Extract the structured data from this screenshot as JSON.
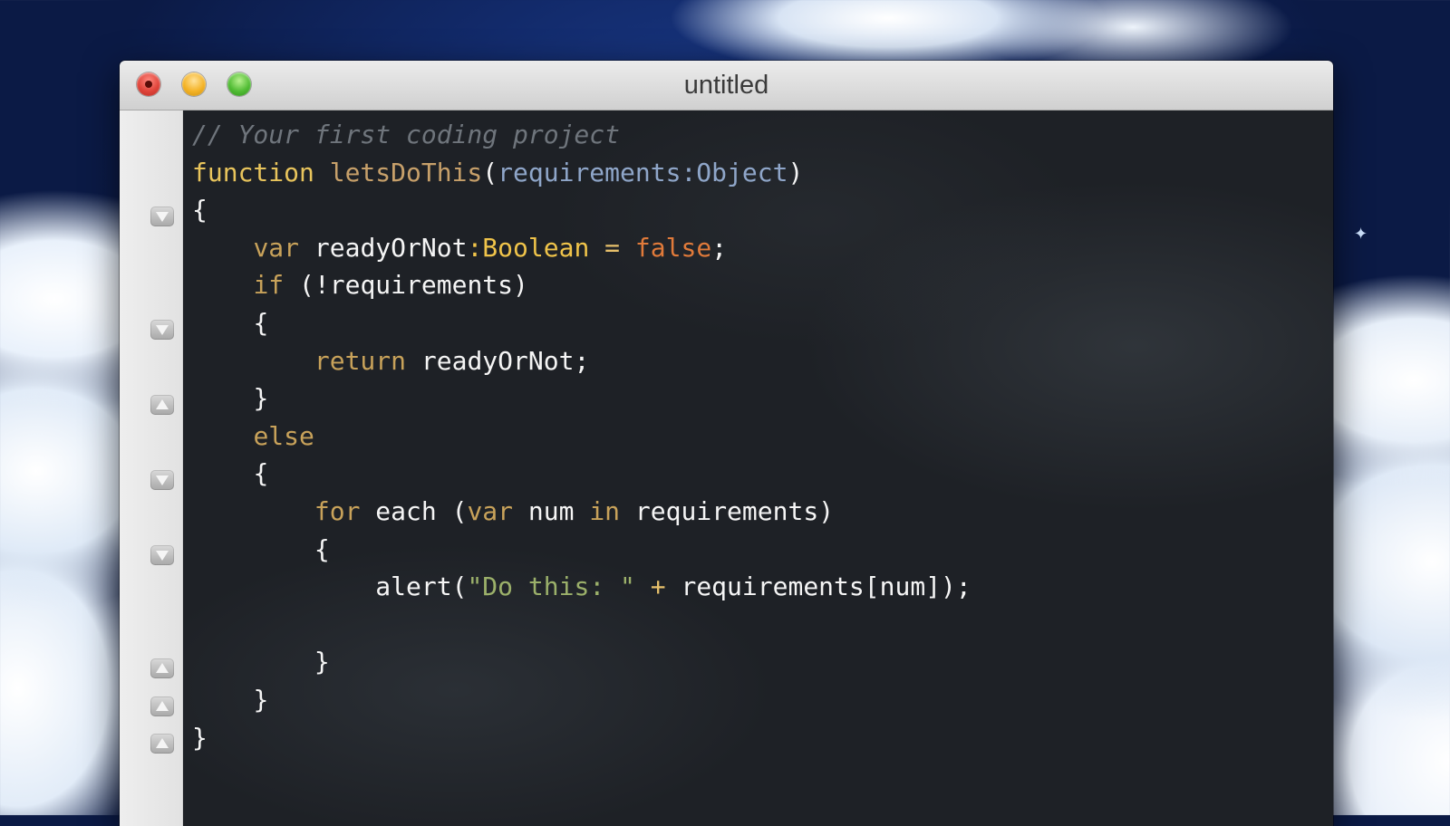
{
  "window": {
    "title": "untitled",
    "traffic_lights": {
      "close": "#e0443a",
      "minimize": "#f4b326",
      "zoom": "#52bd35"
    }
  },
  "gutter": {
    "fold_markers": [
      {
        "line": 3,
        "direction": "collapse",
        "icon": "fold-down-icon"
      },
      {
        "line": 6,
        "direction": "collapse",
        "icon": "fold-down-icon"
      },
      {
        "line": 8,
        "direction": "expand",
        "icon": "fold-up-icon"
      },
      {
        "line": 10,
        "direction": "collapse",
        "icon": "fold-down-icon"
      },
      {
        "line": 12,
        "direction": "collapse",
        "icon": "fold-down-icon"
      },
      {
        "line": 15,
        "direction": "expand",
        "icon": "fold-up-icon"
      },
      {
        "line": 16,
        "direction": "expand",
        "icon": "fold-up-icon"
      },
      {
        "line": 17,
        "direction": "expand",
        "icon": "fold-up-icon"
      }
    ]
  },
  "code": {
    "l1": {
      "comment": "// Your first coding project"
    },
    "l2": {
      "kw": "function",
      "name": "letsDoThis",
      "open": "(",
      "param": "requirements:Object",
      "close": ")"
    },
    "l3": {
      "text": "{"
    },
    "l4": {
      "indent": "    ",
      "kw": "var",
      "name": " readyOrNot",
      "type": ":Boolean",
      "op": " = ",
      "bool": "false",
      "end": ";"
    },
    "l5": {
      "indent": "    ",
      "kw": "if",
      "rest": " (!requirements)"
    },
    "l6": {
      "indent": "    ",
      "text": "{"
    },
    "l7": {
      "indent": "        ",
      "kw": "return",
      "rest": " readyOrNot;"
    },
    "l8": {
      "indent": "    ",
      "text": "}"
    },
    "l9": {
      "indent": "    ",
      "kw": "else"
    },
    "l10": {
      "indent": "    ",
      "text": "{"
    },
    "l11": {
      "indent": "        ",
      "kw": "for",
      "t1": " each (",
      "kw2": "var",
      "t2": " num ",
      "kw3": "in",
      "t3": " requirements)"
    },
    "l12": {
      "indent": "        ",
      "text": "{"
    },
    "l13": {
      "indent": "            ",
      "t1": "alert(",
      "str": "\"Do this: \"",
      "op": " + ",
      "t2": "requirements[num]);"
    },
    "l14": {
      "text": ""
    },
    "l15": {
      "indent": "        ",
      "text": "}"
    },
    "l16": {
      "indent": "    ",
      "text": "}"
    },
    "l17": {
      "text": "}"
    }
  },
  "colors": {
    "editor_bg": "#1e2126",
    "comment": "#6f757c",
    "keyword": "#e8c45c",
    "function_name": "#c7a06a",
    "parameter": "#8fa6c9",
    "type": "#f0c44a",
    "boolean": "#e07a3a",
    "string": "#9bb06a"
  }
}
